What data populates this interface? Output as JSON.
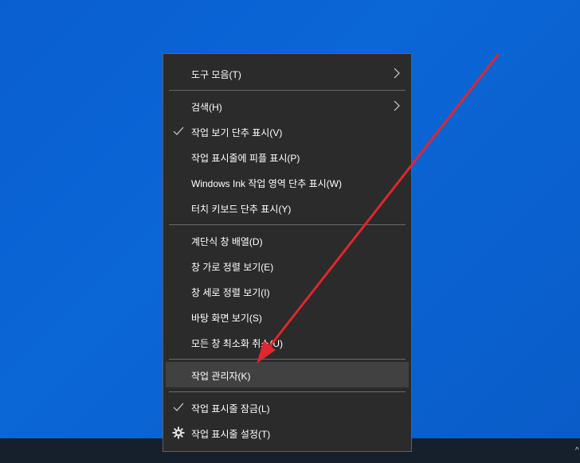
{
  "menu": {
    "items": [
      {
        "label": "도구 모음(T)",
        "submenu": true
      },
      {
        "label": "검색(H)",
        "submenu": true
      },
      {
        "label": "작업 보기 단추 표시(V)",
        "checked": true
      },
      {
        "label": "작업 표시줄에 피플 표시(P)"
      },
      {
        "label": "Windows Ink 작업 영역 단추 표시(W)"
      },
      {
        "label": "터치 키보드 단추 표시(Y)"
      },
      {
        "label": "계단식 창 배열(D)"
      },
      {
        "label": "창 가로 정렬 보기(E)"
      },
      {
        "label": "창 세로 정렬 보기(I)"
      },
      {
        "label": "바탕 화면 보기(S)"
      },
      {
        "label": "모든 창 최소화 취소(U)"
      },
      {
        "label": "작업 관리자(K)",
        "highlighted": true
      },
      {
        "label": "작업 표시줄 잠금(L)",
        "checked": true
      },
      {
        "label": "작업 표시줄 설정(T)",
        "icon": "gear-icon"
      }
    ]
  },
  "colors": {
    "desktop": "#0a5fd0",
    "menu_bg": "#2b2b2b",
    "hover_bg": "#414141",
    "annotation_arrow": "#e0262e"
  }
}
